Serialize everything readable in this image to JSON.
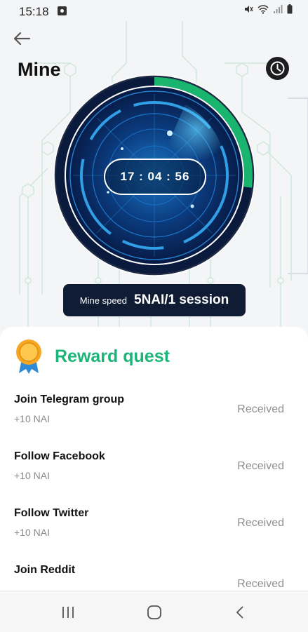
{
  "status_bar": {
    "time": "15:18"
  },
  "header": {
    "title": "Mine"
  },
  "timer": {
    "value": "17 : 04 : 56",
    "progress_fraction": 0.27
  },
  "mining": {
    "speed_label": "Mine speed",
    "speed_value": "5NAI/1 session"
  },
  "reward": {
    "title": "Reward quest",
    "quests": [
      {
        "name": "Join Telegram group",
        "reward": "+10 NAI",
        "status": "Received"
      },
      {
        "name": "Follow Facebook",
        "reward": "+10 NAI",
        "status": "Received"
      },
      {
        "name": "Follow Twitter",
        "reward": "+10 NAI",
        "status": "Received"
      },
      {
        "name": "Join Reddit",
        "reward": "",
        "status": "Received"
      }
    ]
  },
  "colors": {
    "accent": "#1bb57a",
    "progress": "#19b46e",
    "dark": "#0f1c33"
  },
  "icons": [
    "back-arrow-icon",
    "history-clock-icon",
    "medal-icon",
    "recents-icon",
    "home-icon",
    "back-icon"
  ]
}
